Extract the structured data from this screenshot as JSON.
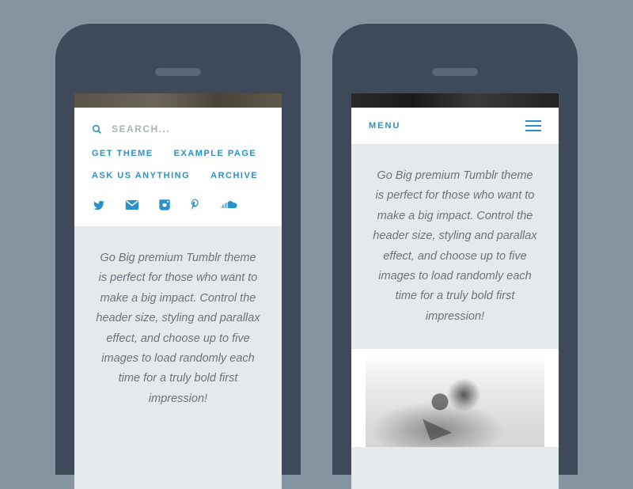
{
  "left": {
    "search": {
      "placeholder": "SEARCH..."
    },
    "nav": {
      "get_theme": "GET THEME",
      "example_page": "EXAMPLE PAGE",
      "ask": "ASK US ANYTHING",
      "archive": "ARCHIVE"
    },
    "paragraph": "Go Big premium Tumblr theme is perfect for those who want to make a big impact. Control the header size, styling and parallax effect, and choose up to five images to load randomly each time for a truly bold first impression!"
  },
  "right": {
    "menu_label": "MENU",
    "paragraph": "Go Big premium Tumblr theme is perfect for those who want to make a big impact. Control the header size, styling and parallax effect, and choose up to five images to load randomly each time for a truly bold first impression!"
  }
}
